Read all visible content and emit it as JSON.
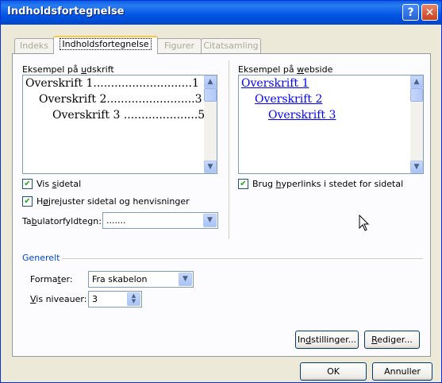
{
  "window": {
    "title": "Indholdsfortegnelse",
    "help_label": "?",
    "close_label": "✕"
  },
  "tabs": [
    {
      "label": "Indeks",
      "active": false
    },
    {
      "label": "Indholdsfortegnelse",
      "active": true
    },
    {
      "label": "Figurer",
      "active": false
    },
    {
      "label": "Citatsamling",
      "active": false
    }
  ],
  "print_preview": {
    "label": "Eksempel på udskrift",
    "lines": [
      {
        "text": "Overskrift 1",
        "page": "1"
      },
      {
        "text": "Overskrift 2",
        "page": "3"
      },
      {
        "text": "Overskrift 3",
        "page": "5"
      }
    ]
  },
  "web_preview": {
    "label": "Eksempel på webside",
    "links": [
      "Overskrift 1",
      "Overskrift 2",
      "Overskrift 3"
    ],
    "link_color": "#0000ff"
  },
  "options": {
    "show_page_numbers": {
      "label": "Vis sidetal",
      "checked": true
    },
    "right_align": {
      "label": "Højrejuster sidetal og henvisninger",
      "checked": true
    },
    "tab_leader": {
      "label": "Tabulatorfyldtegn:",
      "value": "......."
    },
    "use_hyperlinks": {
      "label": "Brug hyperlinks i stedet for sidetal",
      "checked": true
    }
  },
  "general": {
    "label": "Generelt",
    "formats": {
      "label": "Formater:",
      "value": "Fra skabelon"
    },
    "levels": {
      "label": "Vis niveauer:",
      "value": "3"
    }
  },
  "buttons": {
    "options": "Indstillinger...",
    "modify": "Rediger...",
    "ok": "OK",
    "cancel": "Annuller"
  },
  "check_glyph": "✔"
}
